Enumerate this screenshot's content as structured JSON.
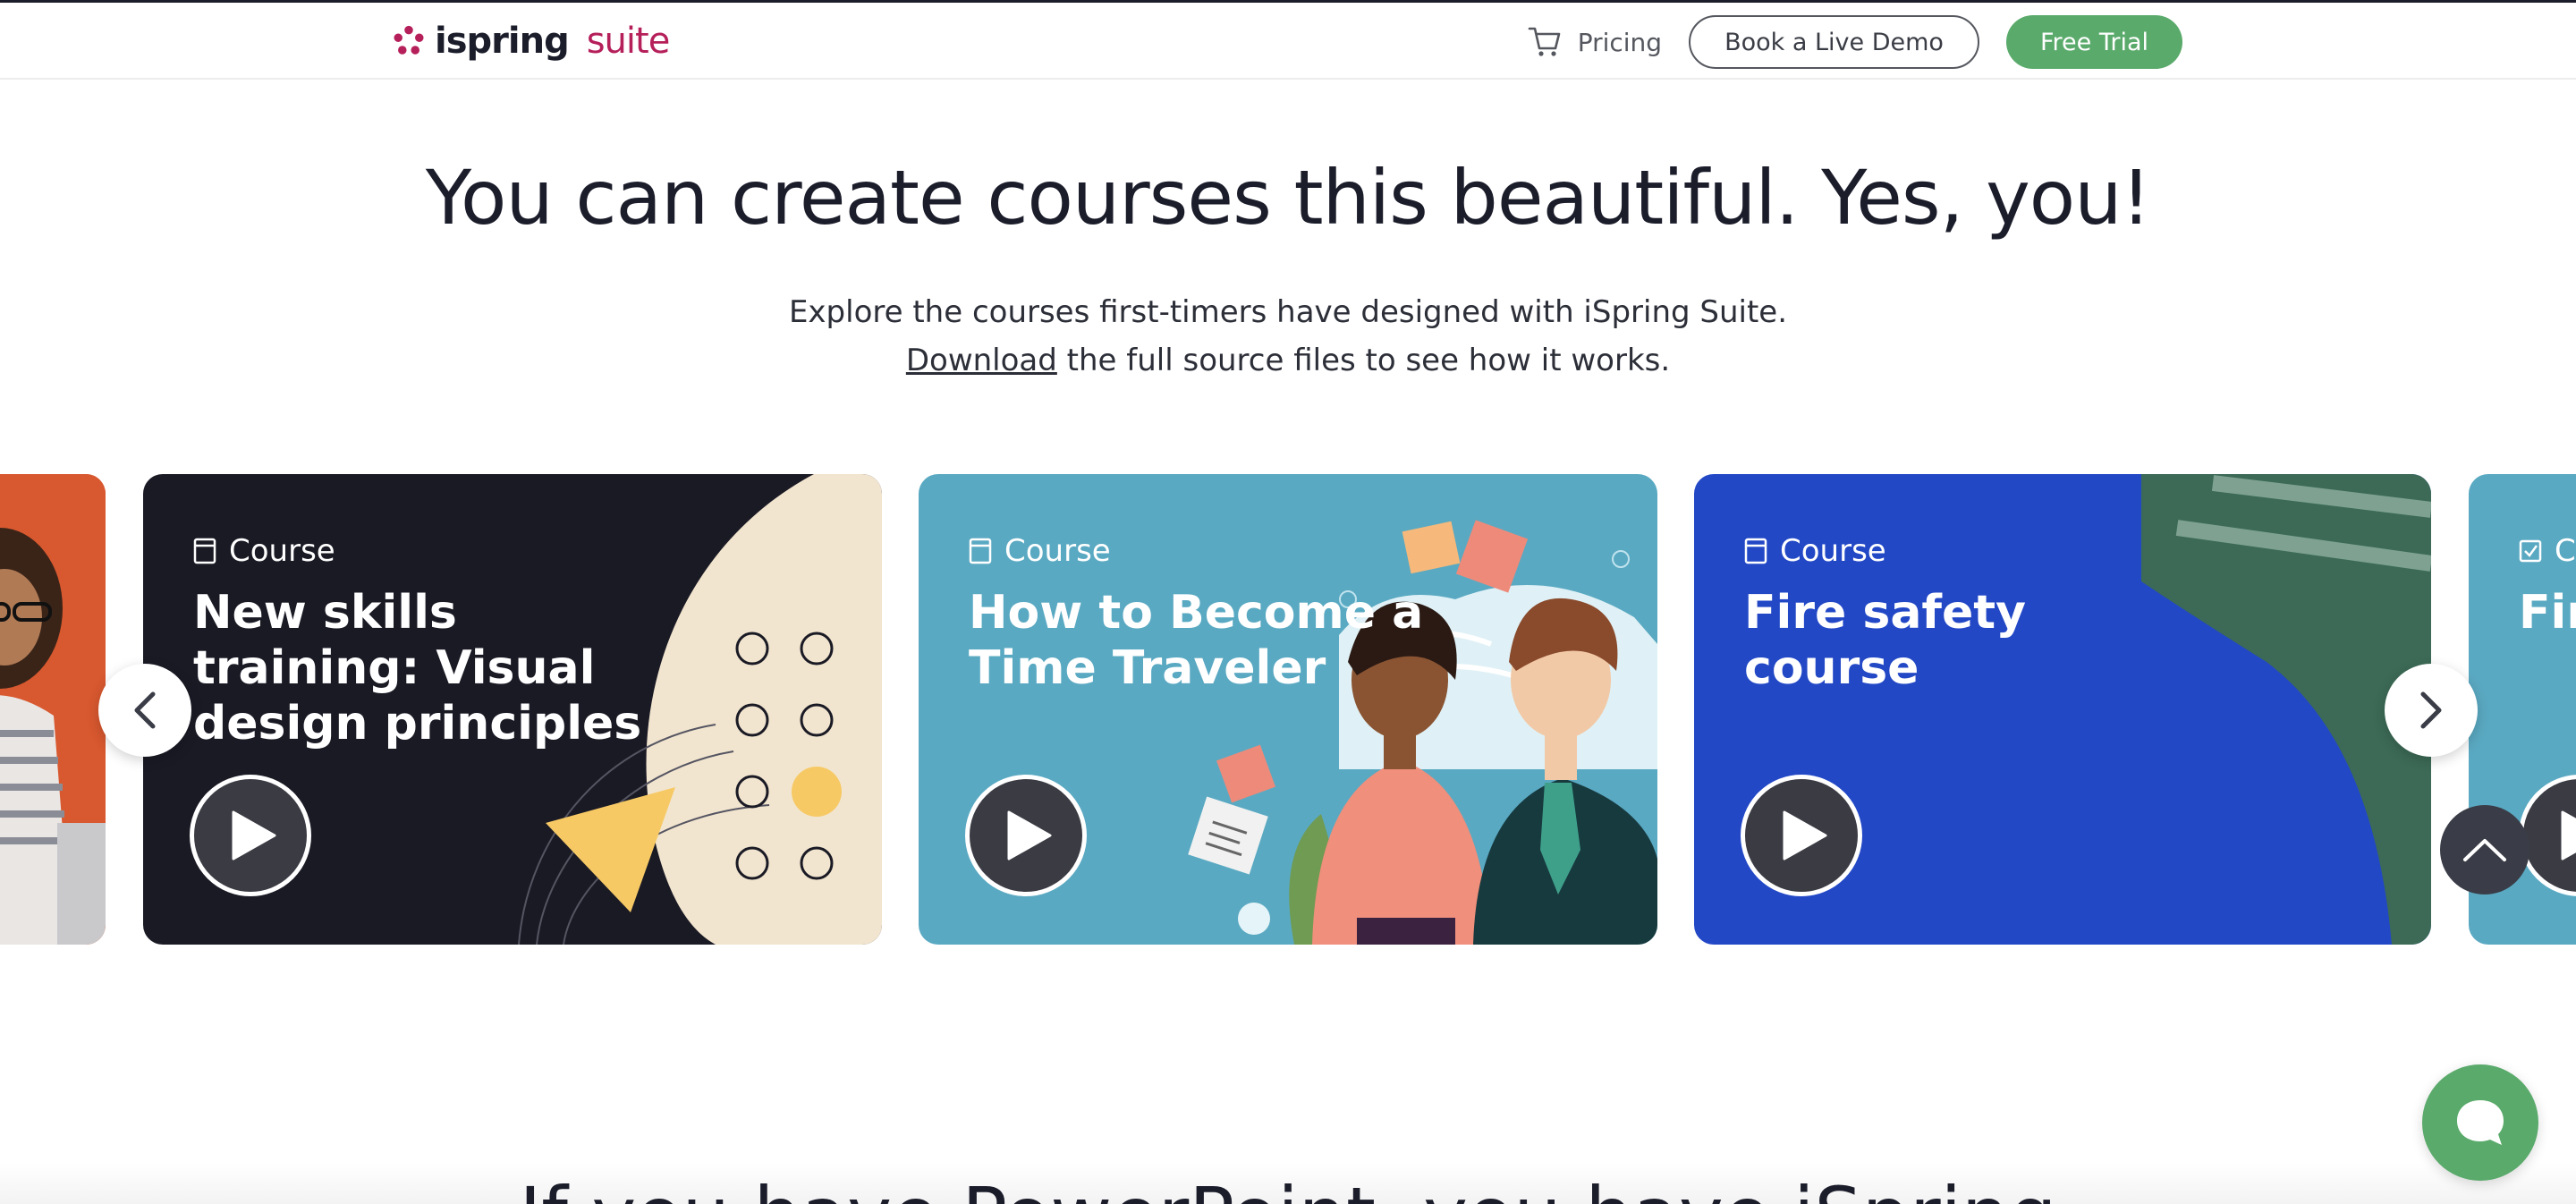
{
  "brand": {
    "logo_name": "ispring",
    "logo_suite": "suite",
    "accent_color": "#b51f5a",
    "green": "#5aaa6b"
  },
  "nav": {
    "pricing": "Pricing",
    "book_demo": "Book a Live Demo",
    "free_trial": "Free Trial"
  },
  "hero": {
    "title": "You can create courses this beautiful. Yes, you!",
    "subtitle_line1": "Explore the courses first-timers have designed with iSpring Suite.",
    "download_link": "Download",
    "subtitle_line2_rest": " the full source files to see how it works."
  },
  "carousel": {
    "cards": [
      {
        "label": "Course",
        "title": "New skills training: Visual design principles",
        "color": "#1a1a25"
      },
      {
        "label": "Course",
        "title": "How to Become a Time Traveler",
        "color": "#5aa9c2"
      },
      {
        "label": "Course",
        "title": "Fire safety course",
        "color": "#2248c6"
      }
    ],
    "next_card_label": "C",
    "next_card_title": "Fir"
  },
  "bottom": {
    "heading_peek": "If you have PowerPoint, you have iSpring"
  }
}
